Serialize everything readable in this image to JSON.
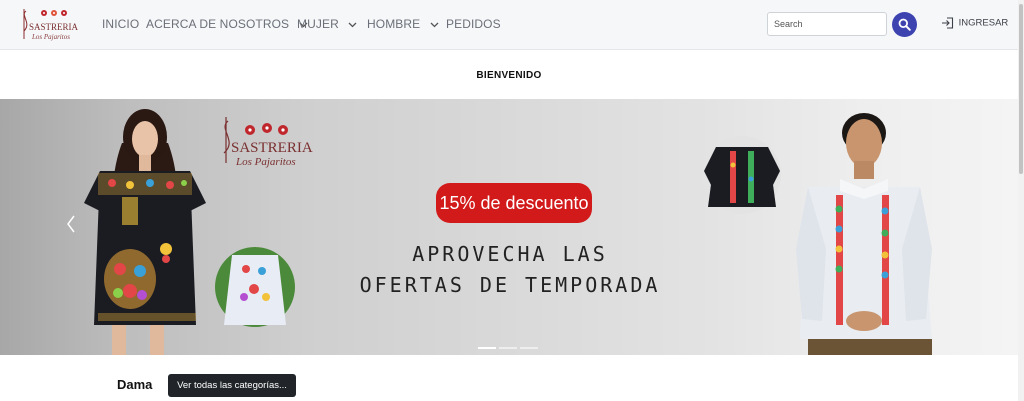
{
  "logo": {
    "line1": "SASTRERIA",
    "line2": "Los Pajaritos",
    "colors": [
      "#c0272d",
      "#e0553b",
      "#8a2b2b"
    ]
  },
  "nav": {
    "items": [
      {
        "label": "INICIO",
        "dropdown": false
      },
      {
        "label": "ACERCA DE NOSOTROS",
        "dropdown": true
      },
      {
        "label": "MUJER",
        "dropdown": true
      },
      {
        "label": "HOMBRE",
        "dropdown": true
      },
      {
        "label": "PEDIDOS",
        "dropdown": false
      }
    ],
    "search_placeholder": "Search",
    "search_icon": "search-icon",
    "login_label": "INGRESAR",
    "login_icon": "sign-in-icon"
  },
  "welcome": "BIENVENIDO",
  "banner": {
    "promo": "15% de descuento",
    "headline_line1": "APROVECHA LAS",
    "headline_line2": "OFERTAS DE TEMPORADA",
    "logo_line1": "SASTRERIA",
    "logo_line2": "Los Pajaritos",
    "slides": 3,
    "active_slide": 1,
    "accent_color": "#d21a1a"
  },
  "section": {
    "title": "Dama",
    "button_label": "Ver todas las categorías..."
  },
  "colors": {
    "primary": "#3d44b0",
    "dark_button": "#212529",
    "navbar_bg": "#f6f7f9"
  }
}
